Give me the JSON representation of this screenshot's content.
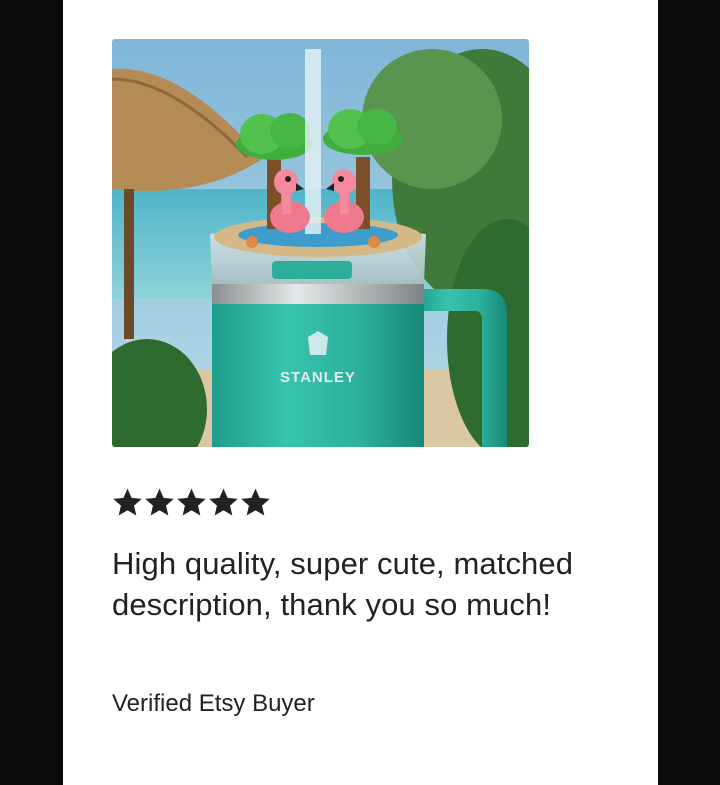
{
  "review": {
    "rating": 5,
    "rating_max": 5,
    "text": "High quality, super cute, matched description, thank you so much!",
    "reviewer": "Verified Etsy Buyer"
  },
  "photo": {
    "brand_text": "STANLEY"
  },
  "colors": {
    "star": "#222222",
    "background": "#ffffff",
    "frame": "#0b0b0b",
    "text": "#222222"
  },
  "icons": [
    "star-icon"
  ]
}
